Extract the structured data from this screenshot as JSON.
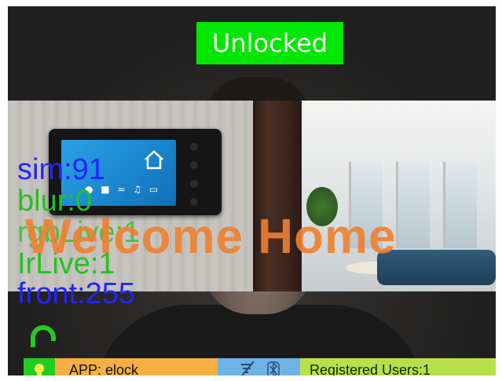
{
  "status": {
    "label": "Unlocked",
    "color": "#00ee00"
  },
  "banner": {
    "welcome_text": "Welcome Home",
    "color": "#f08030"
  },
  "metrics": [
    {
      "text": "sim:91",
      "color": "#2424ff"
    },
    {
      "text": "blur:0",
      "color": "#22c222"
    },
    {
      "text": "IrLive:1",
      "color": "#22c222"
    },
    {
      "text": "front:255",
      "color": "#2424ff"
    }
  ],
  "metrics_hidden": {
    "text": "rgbLive:1"
  },
  "bottom_bar": {
    "app_label": "APP: elock",
    "registered_label": "Registered Users:1",
    "icons": [
      "wifi-icon",
      "bluetooth-icon"
    ],
    "colors": {
      "app": "#f5b041",
      "icons": "#6eb3e6",
      "users": "#b9e04a",
      "lock": "#22cc22"
    }
  },
  "lock_icon": {
    "name": "unlocked-padlock-icon",
    "color": "#22cc22"
  }
}
